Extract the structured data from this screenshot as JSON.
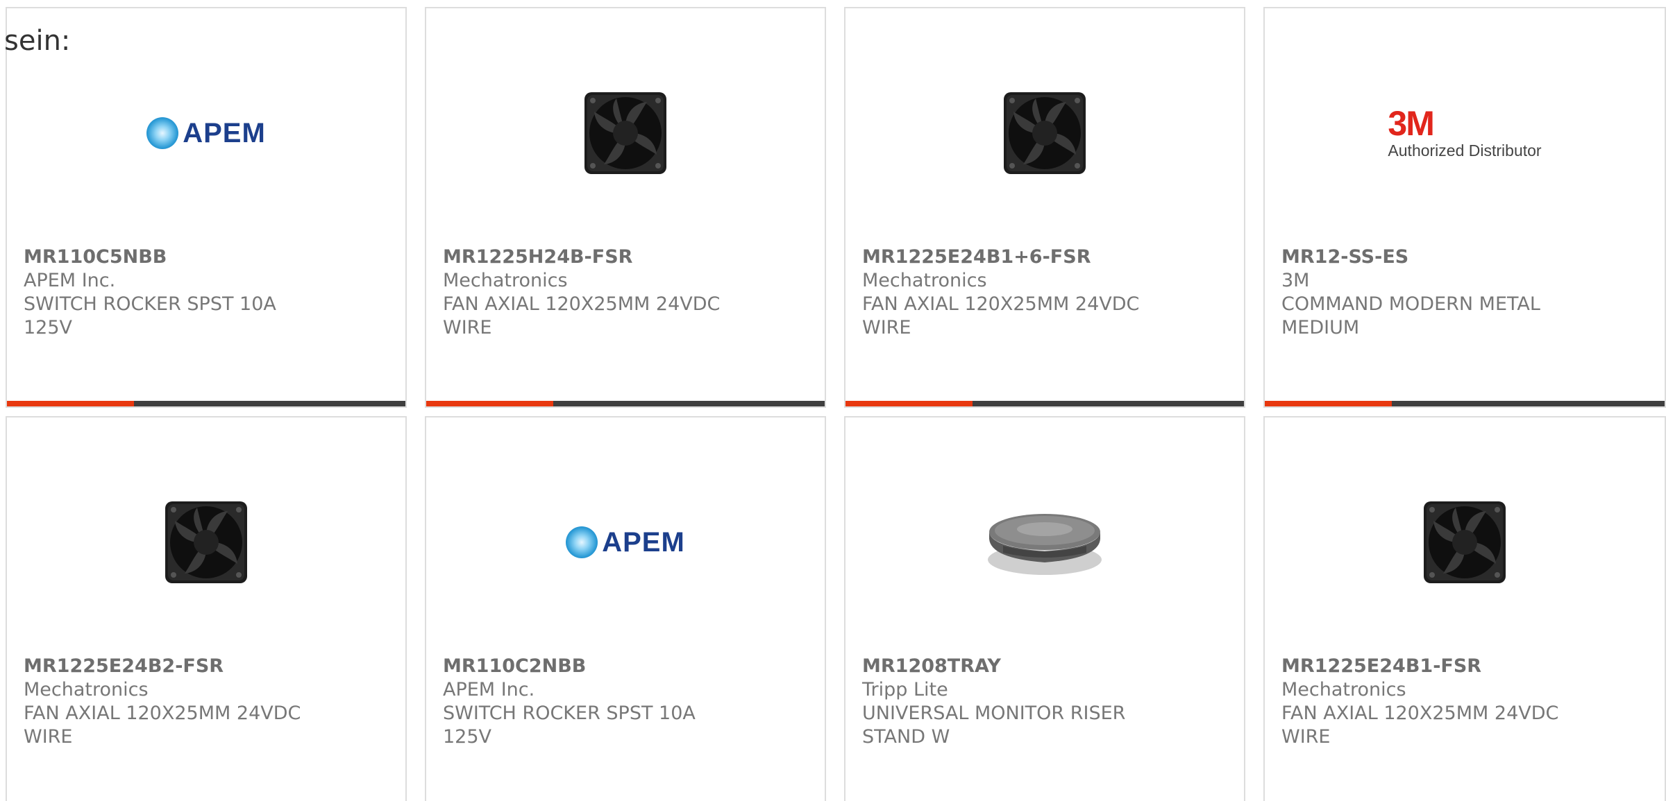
{
  "lead_text": "sein:",
  "colors": {
    "accent": "#e8380f",
    "bar": "#3f3f3f",
    "apem_blue": "#1c3f8c",
    "threem_red": "#e1261c"
  },
  "products": [
    {
      "part_number": "MR110C5NBB",
      "manufacturer": "APEM Inc.",
      "description": "SWITCH ROCKER SPST 10A 125V",
      "image": "apem-logo",
      "logo_text": "APEM"
    },
    {
      "part_number": "MR1225H24B-FSR",
      "manufacturer": "Mechatronics",
      "description": "FAN AXIAL 120X25MM 24VDC WIRE",
      "image": "fan-icon"
    },
    {
      "part_number": "MR1225E24B1+6-FSR",
      "manufacturer": "Mechatronics",
      "description": "FAN AXIAL 120X25MM 24VDC WIRE",
      "image": "fan-icon"
    },
    {
      "part_number": "MR12-SS-ES",
      "manufacturer": "3M",
      "description": "COMMAND MODERN METAL MEDIUM",
      "image": "3m-logo",
      "logo_text": "3M",
      "logo_subtext": "Authorized Distributor"
    },
    {
      "part_number": "MR1225E24B2-FSR",
      "manufacturer": "Mechatronics",
      "description": "FAN AXIAL 120X25MM 24VDC WIRE",
      "image": "fan-icon"
    },
    {
      "part_number": "MR110C2NBB",
      "manufacturer": "APEM Inc.",
      "description": "SWITCH ROCKER SPST 10A 125V",
      "image": "apem-logo",
      "logo_text": "APEM"
    },
    {
      "part_number": "MR1208TRAY",
      "manufacturer": "Tripp Lite",
      "description": "UNIVERSAL MONITOR RISER STAND W",
      "image": "monitor-riser-icon"
    },
    {
      "part_number": "MR1225E24B1-FSR",
      "manufacturer": "Mechatronics",
      "description": "FAN AXIAL 120X25MM 24VDC WIRE",
      "image": "fan-icon"
    }
  ]
}
